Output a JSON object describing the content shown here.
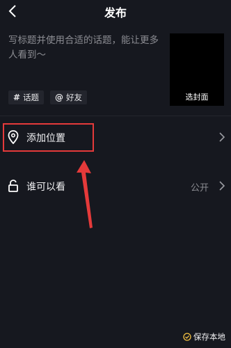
{
  "header": {
    "title": "发布"
  },
  "compose": {
    "caption_placeholder": "写标题并使用合适的话题，能让更多人看到～",
    "cover_label": "选封面",
    "chips": [
      {
        "icon": "#",
        "label": "话题"
      },
      {
        "icon": "@",
        "label": "好友"
      }
    ]
  },
  "rows": {
    "location": {
      "label": "添加位置"
    },
    "visibility": {
      "label": "谁可以看",
      "value": "公开"
    }
  },
  "footer": {
    "save_local": "保存本地"
  },
  "colors": {
    "background": "#16181f",
    "highlight": "#e53a3a",
    "accent": "#f5c242"
  }
}
